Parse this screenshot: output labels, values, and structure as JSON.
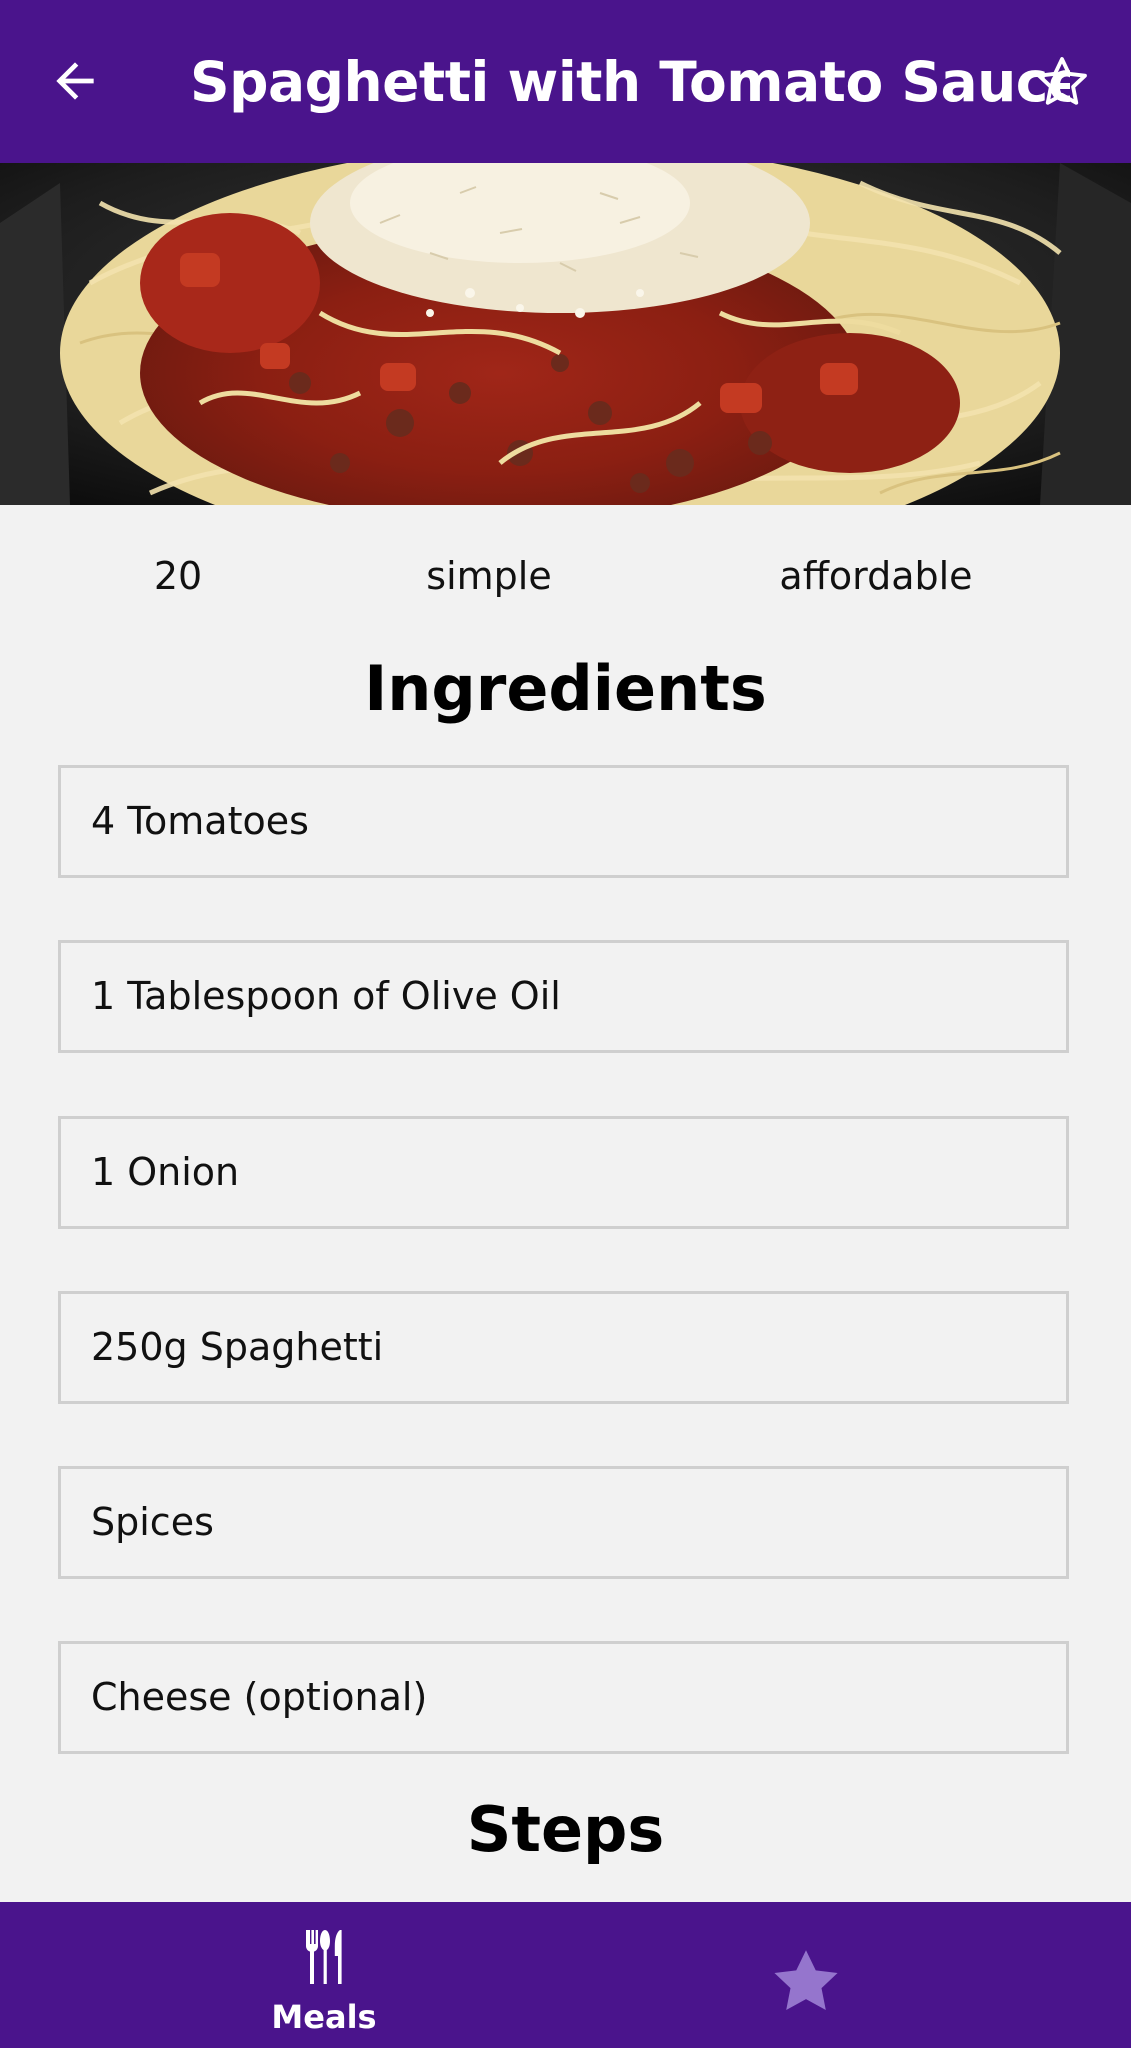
{
  "appbar": {
    "title": "Spaghetti with Tomato Sauce",
    "back_icon": "arrow-left-icon",
    "favorite_icon": "star-outline-icon"
  },
  "meta": {
    "duration": "20",
    "complexity": "simple",
    "affordability": "affordable"
  },
  "ingredients": {
    "title": "Ingredients",
    "items": [
      "4 Tomatoes",
      "1 Tablespoon of Olive Oil",
      "1 Onion",
      "250g Spaghetti",
      "Spices",
      "Cheese (optional)"
    ]
  },
  "steps": {
    "title": "Steps"
  },
  "tabbar": {
    "tabs": [
      {
        "label": "Meals",
        "icon": "utensils-icon",
        "active": true
      },
      {
        "label": "",
        "icon": "star-icon",
        "active": false
      }
    ]
  },
  "colors": {
    "primary": "#4a148c",
    "background": "#f2f2f2",
    "inactive_tab_icon": "#9575cd",
    "border": "#cfcfcf"
  }
}
